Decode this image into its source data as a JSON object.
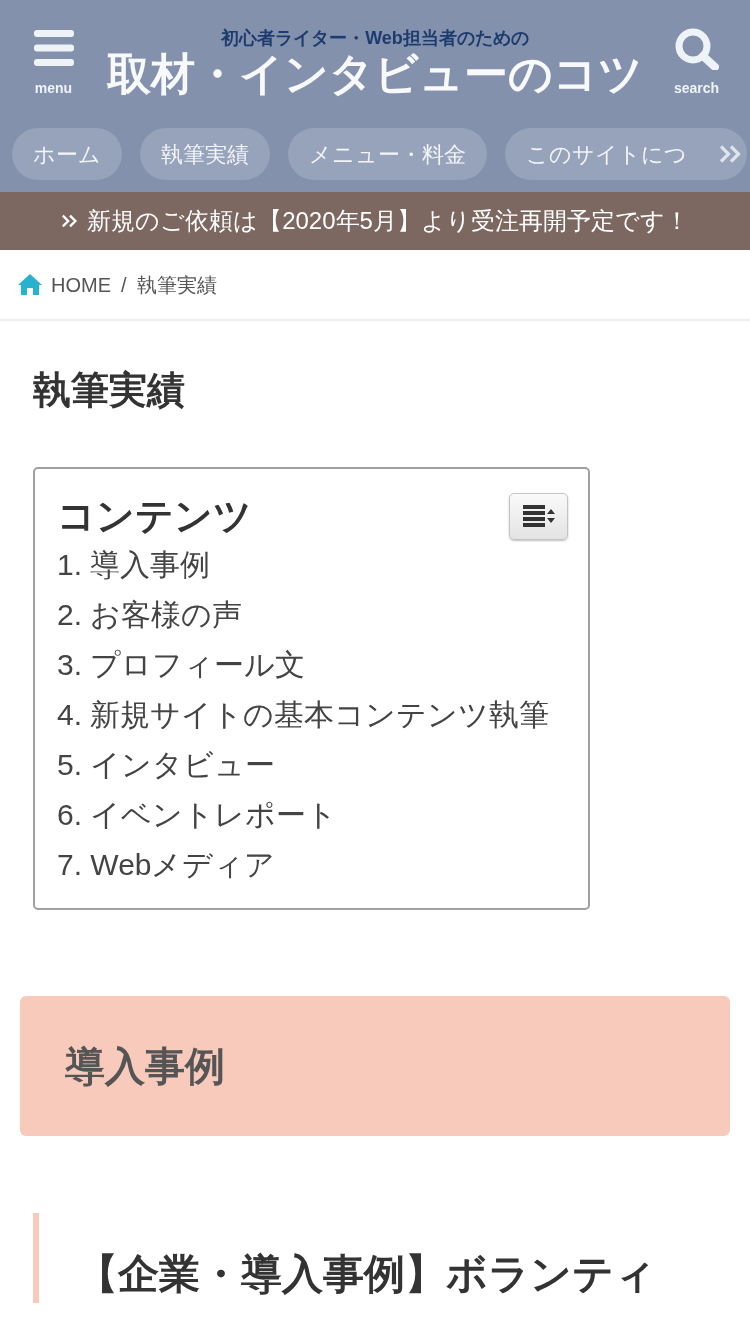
{
  "header": {
    "menu_label": "menu",
    "tagline": "初心者ライター・Web担当者のための",
    "site_title": "取材・インタビューのコツ",
    "search_label": "search"
  },
  "nav": {
    "items": [
      {
        "label": "ホーム"
      },
      {
        "label": "執筆実績"
      },
      {
        "label": "メニュー・料金"
      },
      {
        "label": "このサイトにつ"
      }
    ]
  },
  "notice": {
    "text": "新規のご依頼は【2020年5月】より受注再開予定です！"
  },
  "breadcrumb": {
    "items": [
      "HOME",
      "執筆実績"
    ],
    "separator": "/"
  },
  "page_title": "執筆実績",
  "toc": {
    "title": "コンテンツ",
    "items": [
      "1. 導入事例",
      "2. お客様の声",
      "3. プロフィール文",
      "4. 新規サイトの基本コンテンツ執筆",
      "5. インタビュー",
      "6. イベントレポート",
      "7. Webメディア"
    ]
  },
  "section_heading": "導入事例",
  "article_heading": "【企業・導入事例】ボランティ"
}
